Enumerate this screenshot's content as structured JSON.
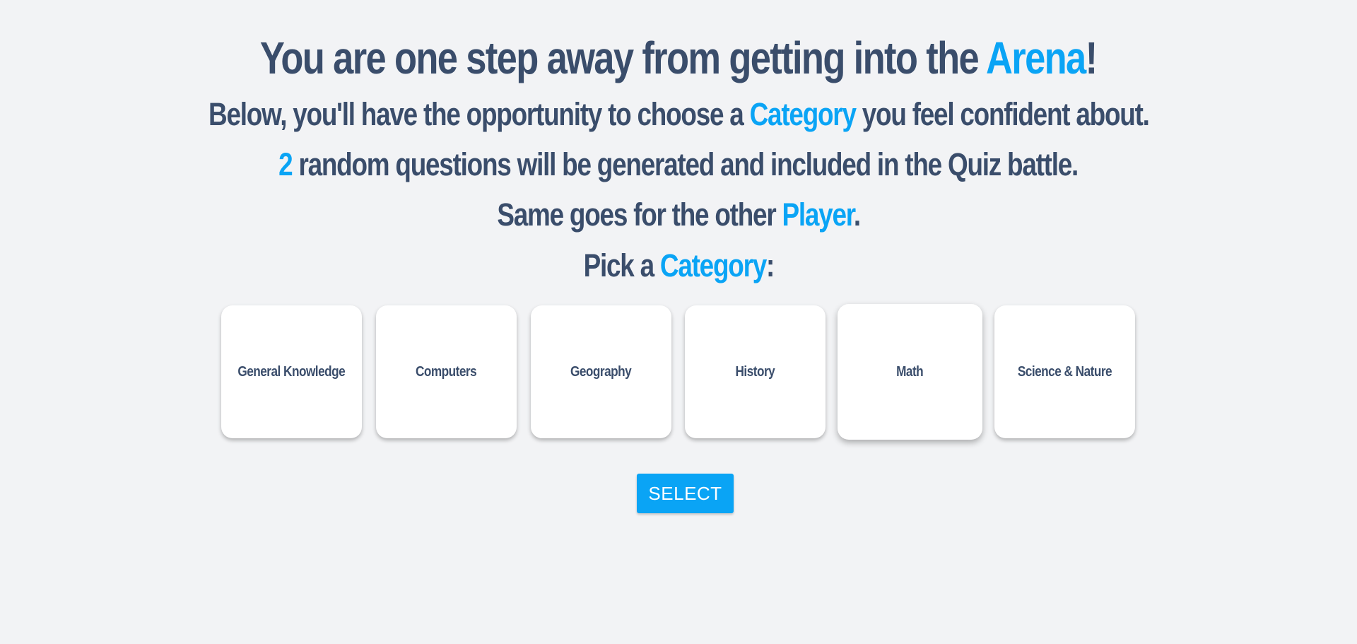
{
  "intro": {
    "line1": {
      "before": "You are one step away from getting into the ",
      "highlight": "Arena",
      "after": "!"
    },
    "line2": {
      "before": "Below, you'll have the opportunity to choose a ",
      "highlight": "Category",
      "after": " you feel confident about."
    },
    "line3": {
      "highlight": "2",
      "after": " random questions will be generated and included in the Quiz battle."
    },
    "line4": {
      "before": "Same goes for the other ",
      "highlight": "Player",
      "after": "."
    },
    "line5": {
      "before": "Pick a ",
      "highlight": "Category",
      "after": ":"
    }
  },
  "categories": [
    {
      "label": "General Knowledge"
    },
    {
      "label": "Computers"
    },
    {
      "label": "Geography"
    },
    {
      "label": "History"
    },
    {
      "label": "Math"
    },
    {
      "label": "Science & Nature"
    }
  ],
  "actions": {
    "select_label": "SELECT"
  },
  "colors": {
    "accent": "#0aa4f5",
    "text": "#3a4d6b",
    "background": "#f2f3f5",
    "card": "#ffffff"
  }
}
